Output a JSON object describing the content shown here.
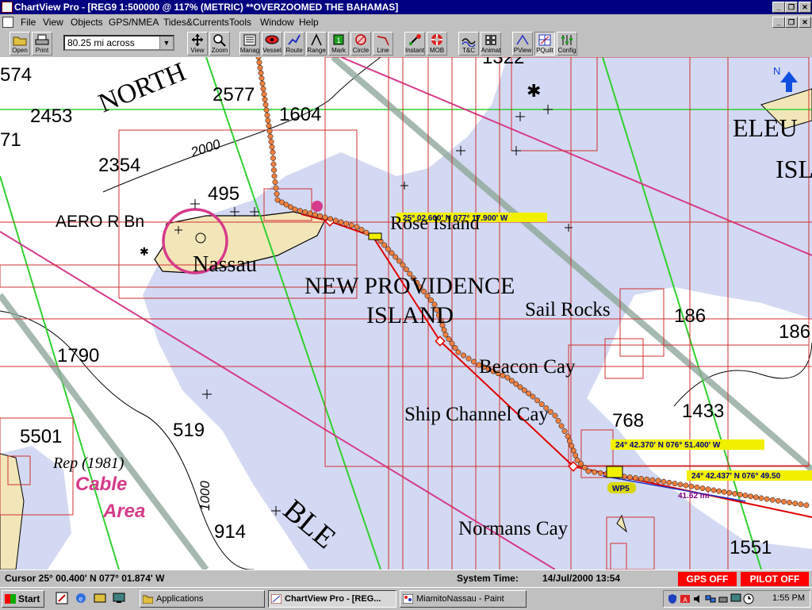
{
  "window": {
    "title": "ChartView Pro - [REG9 1:500000 @ 117% (METRIC) **OVERZOOMED THE BAHAMAS]"
  },
  "menu": [
    "File",
    "View",
    "Objects",
    "GPS/NMEA",
    "Tides&Currents",
    "Tools",
    "Window",
    "Help"
  ],
  "toolbar": {
    "buttons": [
      {
        "label": "Open",
        "icon": "folder-icon"
      },
      {
        "label": "Print",
        "icon": "printer-icon"
      },
      {
        "label": "View",
        "icon": "view-cross-icon"
      },
      {
        "label": "Zoom",
        "icon": "magnifier-icon"
      },
      {
        "label": "Manag",
        "icon": "manager-icon"
      },
      {
        "label": "Vessel",
        "icon": "vessel-icon"
      },
      {
        "label": "Route",
        "icon": "route-icon"
      },
      {
        "label": "Range",
        "icon": "range-icon"
      },
      {
        "label": "Mark",
        "icon": "mark-icon"
      },
      {
        "label": "Circle",
        "icon": "circle-icon"
      },
      {
        "label": "Line",
        "icon": "line-icon"
      },
      {
        "label": "Instant",
        "icon": "instant-icon"
      },
      {
        "label": "MOB",
        "icon": "lifebuoy-icon"
      },
      {
        "label": "T&C",
        "icon": "tides-icon"
      },
      {
        "label": "Animat",
        "icon": "animate-icon"
      },
      {
        "label": "PView",
        "icon": "pview-icon"
      },
      {
        "label": "PQuilt",
        "icon": "pquilt-icon"
      },
      {
        "label": "Config",
        "icon": "config-icon"
      }
    ],
    "scale_value": "80.25 mi across"
  },
  "map": {
    "place_names": {
      "north": "NORTH",
      "eleu": "ELEU",
      "isl": "ISL",
      "nassau": "Nassau",
      "aero": "AERO R Bn",
      "rose": "Rose Island",
      "newprov": "NEW PROVIDENCE",
      "island": "ISLAND",
      "sail": "Sail Rocks",
      "beacon": "Beacon Cay",
      "ship": "Ship Channel Cay",
      "normans": "Normans Cay",
      "rep": "Rep (1981)",
      "cable": "Cable",
      "area": "Area",
      "ble": "BLE"
    },
    "soundings": {
      "s574": "574",
      "s2577": "2577",
      "s1322": "1322",
      "s2453": "2453",
      "s1604": "1604",
      "s71": "71",
      "s2354": "2354",
      "s2000": "2000",
      "s495": "495",
      "s186": "186",
      "s186b": "186",
      "s1790": "1790",
      "s1433": "1433",
      "s768": "768",
      "s5501": "5501",
      "s519": "519",
      "s1000": "1000",
      "s914": "914",
      "s1551": "1551"
    },
    "north_label": "N",
    "waypoint_label": "WP5",
    "range_label": "41.62 mi",
    "position_tags": {
      "rose": "25° 02.600' N 077° 17.900' W",
      "upper": "24° 42.370' N   076° 51.400' W",
      "lower": "24° 42.437' N   076° 49.50"
    }
  },
  "status": {
    "cursor": "Cursor 25° 00.400' N  077° 01.874' W",
    "system_time_label": "System Time:",
    "system_time_value": "14/Jul/2000  13:54",
    "gps": "GPS OFF",
    "pilot": "PILOT OFF"
  },
  "taskbar": {
    "start": "Start",
    "tasks": [
      "Applications",
      "ChartView Pro - [REG...",
      "MiamitoNassau - Paint"
    ],
    "clock": "1:55 PM"
  },
  "colors": {
    "land": "#f2e6b8",
    "shallow": "#d3d9f2",
    "deep": "#ffffff",
    "track_dots": "#f08040",
    "route": "#e00000",
    "grid_red": "#d03030",
    "grid_green": "#30d030",
    "magenta": "#d63a8a",
    "tag_yellow": "#f0f000",
    "title_blue": "#000080"
  }
}
